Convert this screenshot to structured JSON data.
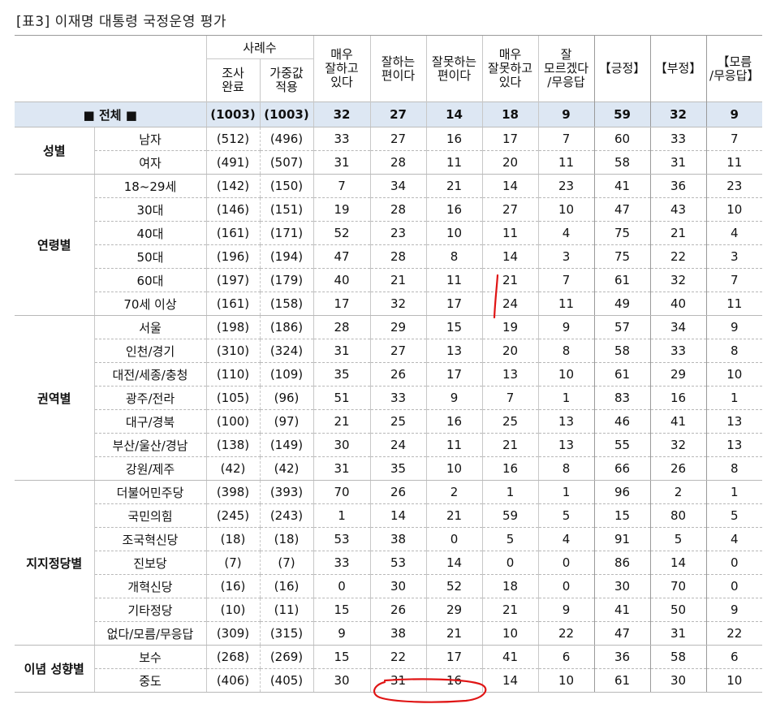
{
  "title": "[표3] 이재명 대통령 국정운영 평가",
  "headers": {
    "cases": "사례수",
    "completed": [
      "조사",
      "완료"
    ],
    "weighted": [
      "가중값",
      "적용"
    ],
    "very_good": [
      "매우",
      "잘하고",
      "있다"
    ],
    "somewhat_good": [
      "잘하는",
      "편이다"
    ],
    "somewhat_bad": [
      "잘못하는",
      "편이다"
    ],
    "very_bad": [
      "매우",
      "잘못하고",
      "있다"
    ],
    "dont_know": [
      "잘",
      "모르겠다",
      "/무응답"
    ],
    "positive": "【긍정】",
    "negative": "【부정】",
    "unknown": [
      "【모름",
      "/무응답】"
    ]
  },
  "total": {
    "label": "■ 전체 ■",
    "values": [
      "(1003)",
      "(1003)",
      "32",
      "27",
      "14",
      "18",
      "9",
      "59",
      "32",
      "9"
    ]
  },
  "groups": [
    {
      "name": "성별",
      "rows": [
        {
          "label": "남자",
          "values": [
            "(512)",
            "(496)",
            "33",
            "27",
            "16",
            "17",
            "7",
            "60",
            "33",
            "7"
          ]
        },
        {
          "label": "여자",
          "values": [
            "(491)",
            "(507)",
            "31",
            "28",
            "11",
            "20",
            "11",
            "58",
            "31",
            "11"
          ]
        }
      ]
    },
    {
      "name": "연령별",
      "rows": [
        {
          "label": "18~29세",
          "values": [
            "(142)",
            "(150)",
            "7",
            "34",
            "21",
            "14",
            "23",
            "41",
            "36",
            "23"
          ]
        },
        {
          "label": "30대",
          "values": [
            "(146)",
            "(151)",
            "19",
            "28",
            "16",
            "27",
            "10",
            "47",
            "43",
            "10"
          ]
        },
        {
          "label": "40대",
          "values": [
            "(161)",
            "(171)",
            "52",
            "23",
            "10",
            "11",
            "4",
            "75",
            "21",
            "4"
          ]
        },
        {
          "label": "50대",
          "values": [
            "(196)",
            "(194)",
            "47",
            "28",
            "8",
            "14",
            "3",
            "75",
            "22",
            "3"
          ]
        },
        {
          "label": "60대",
          "values": [
            "(197)",
            "(179)",
            "40",
            "21",
            "11",
            "21",
            "7",
            "61",
            "32",
            "7"
          ]
        },
        {
          "label": "70세 이상",
          "values": [
            "(161)",
            "(158)",
            "17",
            "32",
            "17",
            "24",
            "11",
            "49",
            "40",
            "11"
          ]
        }
      ]
    },
    {
      "name": "권역별",
      "rows": [
        {
          "label": "서울",
          "values": [
            "(198)",
            "(186)",
            "28",
            "29",
            "15",
            "19",
            "9",
            "57",
            "34",
            "9"
          ]
        },
        {
          "label": "인천/경기",
          "values": [
            "(310)",
            "(324)",
            "31",
            "27",
            "13",
            "20",
            "8",
            "58",
            "33",
            "8"
          ]
        },
        {
          "label": "대전/세종/충청",
          "values": [
            "(110)",
            "(109)",
            "35",
            "26",
            "17",
            "13",
            "10",
            "61",
            "29",
            "10"
          ]
        },
        {
          "label": "광주/전라",
          "values": [
            "(105)",
            "(96)",
            "51",
            "33",
            "9",
            "7",
            "1",
            "83",
            "16",
            "1"
          ]
        },
        {
          "label": "대구/경북",
          "values": [
            "(100)",
            "(97)",
            "21",
            "25",
            "16",
            "25",
            "13",
            "46",
            "41",
            "13"
          ]
        },
        {
          "label": "부산/울산/경남",
          "values": [
            "(138)",
            "(149)",
            "30",
            "24",
            "11",
            "21",
            "13",
            "55",
            "32",
            "13"
          ]
        },
        {
          "label": "강원/제주",
          "values": [
            "(42)",
            "(42)",
            "31",
            "35",
            "10",
            "16",
            "8",
            "66",
            "26",
            "8"
          ]
        }
      ]
    },
    {
      "name": "지지정당별",
      "rows": [
        {
          "label": "더불어민주당",
          "values": [
            "(398)",
            "(393)",
            "70",
            "26",
            "2",
            "1",
            "1",
            "96",
            "2",
            "1"
          ]
        },
        {
          "label": "국민의힘",
          "values": [
            "(245)",
            "(243)",
            "1",
            "14",
            "21",
            "59",
            "5",
            "15",
            "80",
            "5"
          ]
        },
        {
          "label": "조국혁신당",
          "values": [
            "(18)",
            "(18)",
            "53",
            "38",
            "0",
            "5",
            "4",
            "91",
            "5",
            "4"
          ]
        },
        {
          "label": "진보당",
          "values": [
            "(7)",
            "(7)",
            "33",
            "53",
            "14",
            "0",
            "0",
            "86",
            "14",
            "0"
          ]
        },
        {
          "label": "개혁신당",
          "values": [
            "(16)",
            "(16)",
            "0",
            "30",
            "52",
            "18",
            "0",
            "30",
            "70",
            "0"
          ]
        },
        {
          "label": "기타정당",
          "values": [
            "(10)",
            "(11)",
            "15",
            "26",
            "29",
            "21",
            "9",
            "41",
            "50",
            "9"
          ]
        },
        {
          "label": "없다/모름/무응답",
          "values": [
            "(309)",
            "(315)",
            "9",
            "38",
            "21",
            "10",
            "22",
            "47",
            "31",
            "22"
          ]
        }
      ]
    },
    {
      "name": "이념 성향별",
      "rows": [
        {
          "label": "보수",
          "values": [
            "(268)",
            "(269)",
            "15",
            "22",
            "17",
            "41",
            "6",
            "36",
            "58",
            "6"
          ]
        },
        {
          "label": "중도",
          "values": [
            "(406)",
            "(405)",
            "30",
            "31",
            "16",
            "14",
            "10",
            "61",
            "30",
            "10"
          ]
        }
      ]
    }
  ],
  "colors": {
    "total_row_bg": "#dde7f3",
    "annotation_red": "#e01515"
  }
}
